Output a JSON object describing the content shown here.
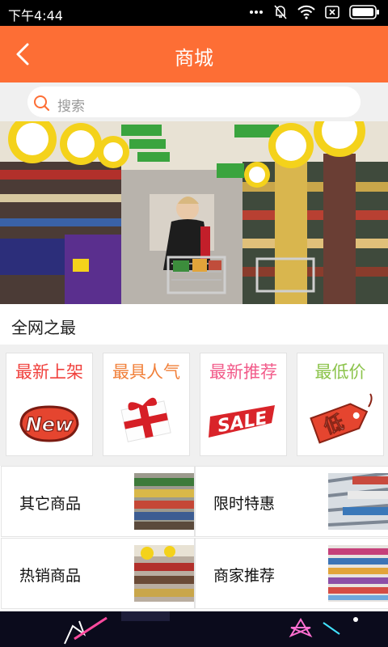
{
  "status_bar": {
    "time": "下午4:44",
    "icons": [
      "more-icon",
      "bell-off-icon",
      "wifi-icon",
      "close-box-icon",
      "battery-icon"
    ]
  },
  "header": {
    "title": "商城",
    "back_icon": "chevron-left-icon"
  },
  "search": {
    "placeholder": "搜索",
    "icon": "search-icon"
  },
  "section": {
    "title": "全网之最"
  },
  "features": [
    {
      "label": "最新上架",
      "color": "#f0413d",
      "art": "new-badge"
    },
    {
      "label": "最具人气",
      "color": "#f1803a",
      "art": "gift-box"
    },
    {
      "label": "最新推荐",
      "color": "#f25b8a",
      "art": "sale-banner"
    },
    {
      "label": "最低价",
      "color": "#8bc34a",
      "art": "price-tag"
    }
  ],
  "categories": [
    {
      "label": "其它商品"
    },
    {
      "label": "限时特惠"
    },
    {
      "label": "热销商品"
    },
    {
      "label": "商家推荐"
    }
  ],
  "colors": {
    "accent": "#fd6e35"
  }
}
